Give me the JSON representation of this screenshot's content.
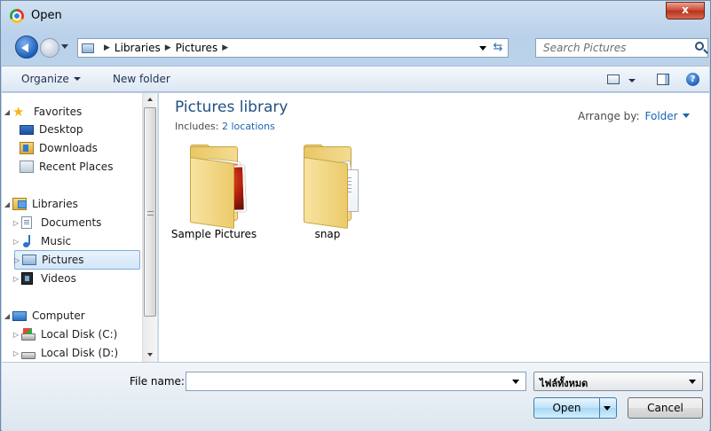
{
  "window": {
    "title": "Open",
    "close_label": "x"
  },
  "address_bar": {
    "crumbs": [
      "Libraries",
      "Pictures"
    ],
    "search_placeholder": "Search Pictures"
  },
  "toolbar": {
    "organize_label": "Organize",
    "new_folder_label": "New folder",
    "help_label": "?"
  },
  "nav": {
    "favorites": {
      "label": "Favorites",
      "items": [
        "Desktop",
        "Downloads",
        "Recent Places"
      ]
    },
    "libraries": {
      "label": "Libraries",
      "items": [
        "Documents",
        "Music",
        "Pictures",
        "Videos"
      ],
      "selected": "Pictures"
    },
    "computer": {
      "label": "Computer",
      "items": [
        "Local Disk (C:)",
        "Local Disk (D:)"
      ]
    }
  },
  "content": {
    "title": "Pictures library",
    "includes_label": "Includes:",
    "includes_link": "2 locations",
    "arrange_label": "Arrange by:",
    "arrange_value": "Folder",
    "folders": [
      "Sample Pictures",
      "snap"
    ]
  },
  "bottom": {
    "file_name_label": "File name:",
    "file_name_value": "",
    "file_type": "ไฟล์ทั้งหมด",
    "open_label": "Open",
    "cancel_label": "Cancel"
  },
  "colors": {
    "accent": "#1f4f82",
    "link": "#1a64b6",
    "selection": "#d3e6fa",
    "close": "#c9452e"
  }
}
